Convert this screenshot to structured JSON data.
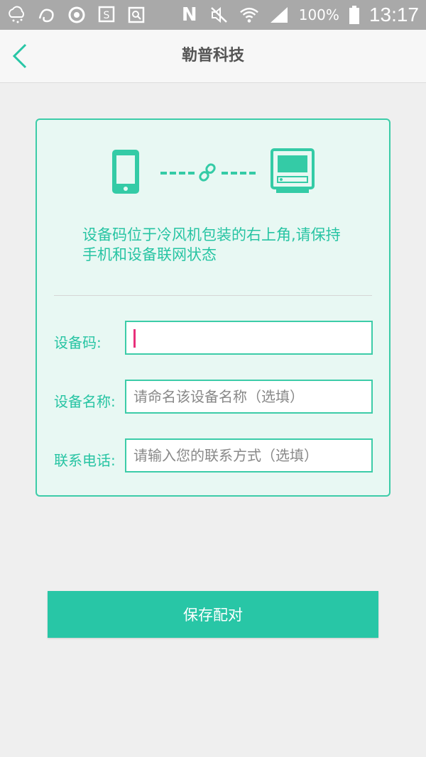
{
  "status_bar": {
    "battery": "100%",
    "time": "13:17",
    "network_letter": "N",
    "icons": [
      "weather-icon",
      "uc-browser-icon",
      "sync-icon",
      "s-app-icon",
      "image-icon",
      "nfc-icon",
      "mute-icon",
      "wifi-icon",
      "signal-icon",
      "battery-icon"
    ]
  },
  "header": {
    "title": "勒普科技"
  },
  "card": {
    "hint": "设备码位于冷风机包装的右上角,请保持手机和设备联网状态",
    "fields": [
      {
        "label": "设备码:",
        "value": "",
        "placeholder": ""
      },
      {
        "label": "设备名称:",
        "value": "",
        "placeholder": "请命名该设备名称（选填）"
      },
      {
        "label": "联系电话:",
        "value": "",
        "placeholder": "请输入您的联系方式（选填）"
      }
    ]
  },
  "button": {
    "label": "保存配对"
  },
  "colors": {
    "accent": "#28c6a6",
    "card_bg": "#e8f8f3",
    "cursor": "#e8307a"
  }
}
